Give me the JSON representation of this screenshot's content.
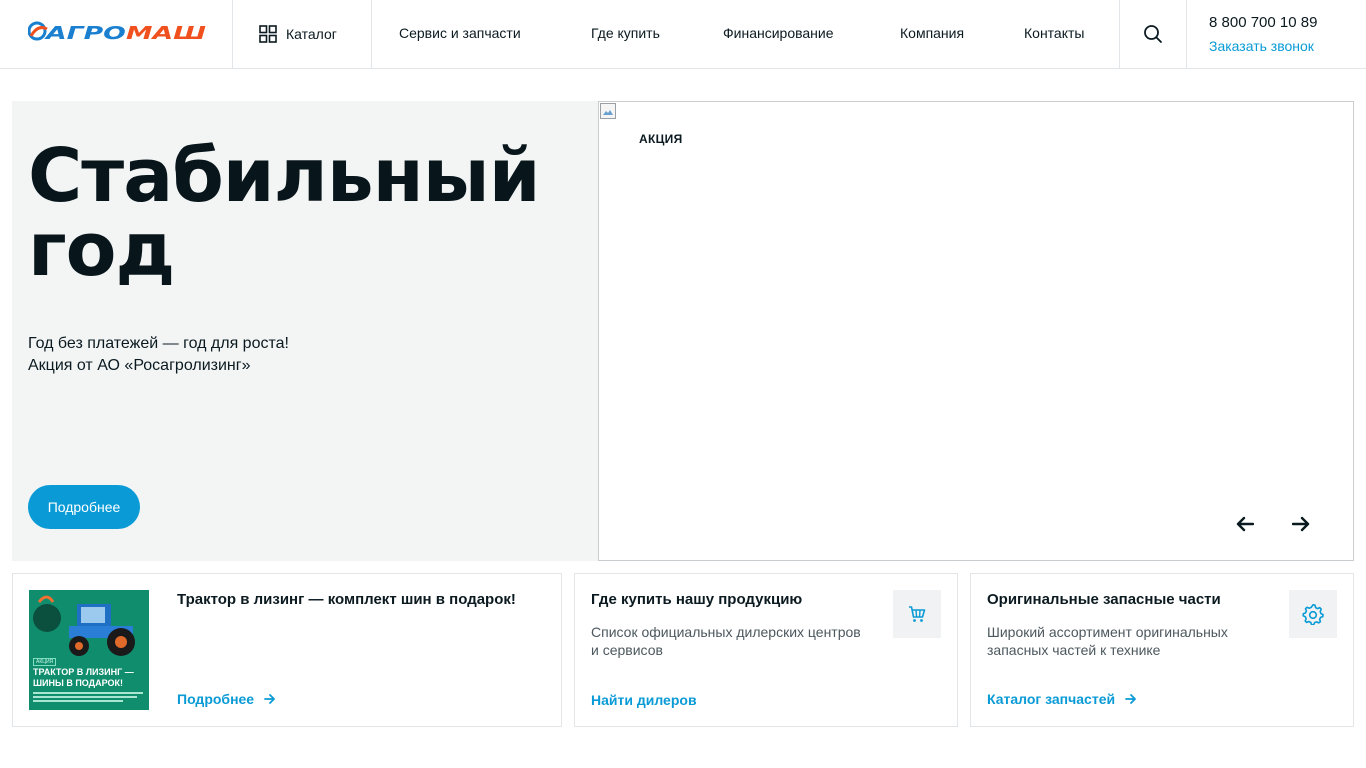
{
  "header": {
    "logo_text": "АГРОМАШ",
    "catalog_label": "Каталог",
    "nav": [
      "Сервис и запчасти",
      "Где купить",
      "Финансирование",
      "Компания",
      "Контакты"
    ],
    "phone": "8 800 700 10 89",
    "callback_label": "Заказать звонок"
  },
  "hero": {
    "title": "Стабильный\nгод",
    "text": "Год без платежей — год для роста!\nАкция от АО «Росагролизинг»",
    "button_label": "Подробнее",
    "tag": "АКЦИЯ"
  },
  "cards": [
    {
      "title": "Трактор в лизинг — комплект шин в подарок!",
      "thumb_tag": "АКЦИЯ",
      "thumb_text": "ТРАКТОР В ЛИЗИНГ —\nШИНЫ В ПОДАРОК!",
      "link_label": "Подробнее"
    },
    {
      "title": "Где купить нашу продукцию",
      "description": "Список официальных дилерских центров\nи сервисов",
      "link_label": "Найти дилеров",
      "icon": "cart-icon"
    },
    {
      "title": "Оригинальные запасные части",
      "description": "Широкий ассортимент оригинальных\nзапасных частей к технике",
      "link_label": "Каталог запчастей",
      "icon": "gear-icon"
    }
  ],
  "colors": {
    "accent": "#0a9bd6",
    "logo_blue": "#1b7fd0",
    "logo_orange": "#f0501e",
    "hero_bg": "#f3f5f5",
    "text_dark": "#0b1a20"
  }
}
